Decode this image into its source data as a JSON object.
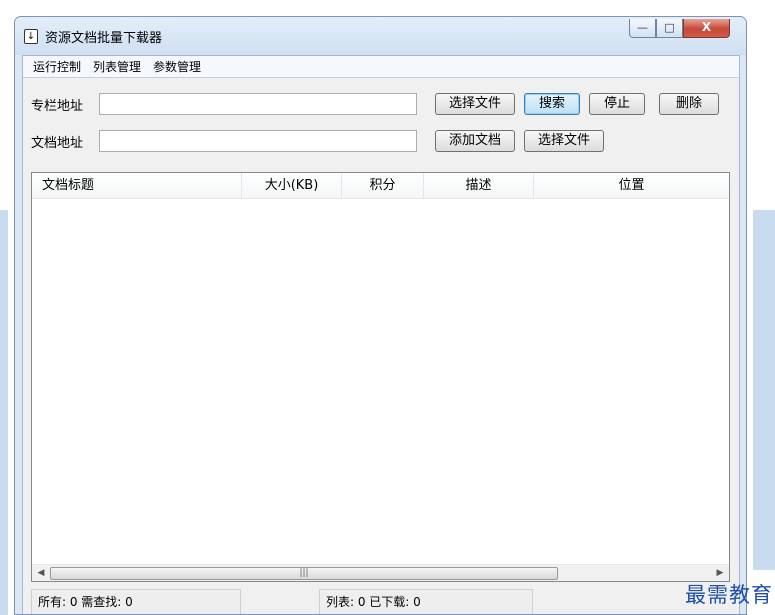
{
  "window": {
    "title": "资源文档批量下载器",
    "icon": "download-arrow-icon"
  },
  "controls": {
    "minimize": "—",
    "maximize": "□",
    "close": "X"
  },
  "menu": [
    {
      "label": "运行控制"
    },
    {
      "label": "列表管理"
    },
    {
      "label": "参数管理"
    }
  ],
  "column_url": {
    "label": "专栏地址",
    "value": ""
  },
  "doc_url": {
    "label": "文档地址",
    "value": ""
  },
  "buttons": {
    "select_file_1": "选择文件",
    "search": "搜索",
    "stop": "停止",
    "delete": "删除",
    "add_doc": "添加文档",
    "select_file_2": "选择文件"
  },
  "list": {
    "columns": [
      "文档标题",
      "大小(KB)",
      "积分",
      "描述",
      "位置"
    ],
    "rows": []
  },
  "status": {
    "left": "所有: 0 需查找: 0",
    "middle": "列表: 0 已下载: 0"
  },
  "watermark": "最需教育"
}
